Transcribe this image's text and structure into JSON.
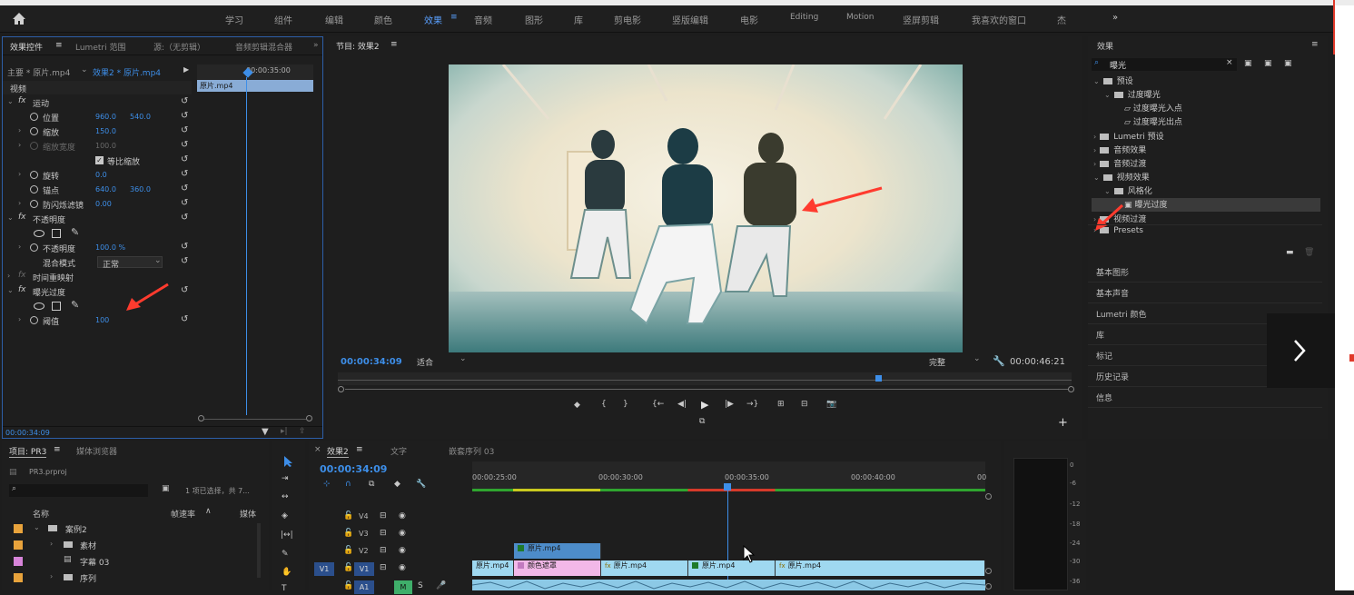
{
  "workspaces": [
    "学习",
    "组件",
    "编辑",
    "颜色",
    "效果",
    "音频",
    "图形",
    "库",
    "剪电影",
    "竖版编辑",
    "电影",
    "Editing",
    "Motion",
    "竖屏剪辑",
    "我喜欢的窗口",
    "杰"
  ],
  "active_workspace": "效果",
  "ec": {
    "tabs": [
      "效果控件",
      "Lumetri 范围",
      "源:（无剪辑）",
      "音频剪辑混合器"
    ],
    "master": "主要 * 原片.mp4",
    "seq": "效果2 * 原片.mp4",
    "mini_time": "00:00:35:00",
    "clip": "原片.mp4",
    "section_video": "视频",
    "motion": "运动",
    "position_lbl": "位置",
    "pos_x": "960.0",
    "pos_y": "540.0",
    "scale_lbl": "缩放",
    "scale": "150.0",
    "scalew_lbl": "缩放宽度",
    "scalew": "100.0",
    "uniform": "等比缩放",
    "rot_lbl": "旋转",
    "rot": "0.0",
    "anchor_lbl": "锚点",
    "anc_x": "640.0",
    "anc_y": "360.0",
    "flicker_lbl": "防闪烁滤镜",
    "flicker": "0.00",
    "opacity": "不透明度",
    "opacity_lbl": "不透明度",
    "opacity_val": "100.0 %",
    "blend_lbl": "混合模式",
    "blend_val": "正常",
    "remap": "时间重映射",
    "solarize": "曝光过度",
    "threshold_lbl": "阈值",
    "threshold": "100",
    "time": "00:00:34:09"
  },
  "program": {
    "title": "节目: 效果2",
    "timecode": "00:00:34:09",
    "fit": "适合",
    "quality": "完整",
    "duration": "00:00:46:21"
  },
  "effects": {
    "title": "效果",
    "search": "曝光",
    "tree": [
      {
        "t": "预设",
        "lvl": 0,
        "f": true
      },
      {
        "t": "过度曝光",
        "lvl": 1,
        "f": true
      },
      {
        "t": "过度曝光入点",
        "lvl": 2,
        "f": false
      },
      {
        "t": "过度曝光出点",
        "lvl": 2,
        "f": false
      },
      {
        "t": "Lumetri 预设",
        "lvl": 0,
        "f": true
      },
      {
        "t": "音频效果",
        "lvl": 0,
        "f": true
      },
      {
        "t": "音频过渡",
        "lvl": 0,
        "f": true
      },
      {
        "t": "视频效果",
        "lvl": 0,
        "f": true
      },
      {
        "t": "风格化",
        "lvl": 1,
        "f": true
      },
      {
        "t": "曝光过度",
        "lvl": 2,
        "f": false
      },
      {
        "t": "视频过渡",
        "lvl": 0,
        "f": true
      },
      {
        "t": "Presets",
        "lvl": 0,
        "f": true
      }
    ],
    "panels": [
      "基本图形",
      "基本声音",
      "Lumetri 颜色",
      "库",
      "标记",
      "历史记录",
      "信息"
    ]
  },
  "project": {
    "tabs": [
      "项目: PR3",
      "媒体浏览器"
    ],
    "file": "PR3.prproj",
    "selinfo": "1 项已选择，共 7...",
    "col_name": "名称",
    "col_rate": "帧速率",
    "col_media": "媒体",
    "items": [
      {
        "name": "案例2",
        "color": "#e8a33c"
      },
      {
        "name": "素材",
        "color": "#e8a33c"
      },
      {
        "name": "字幕 03",
        "color": "#d784d9"
      },
      {
        "name": "序列",
        "color": "#e8a33c"
      }
    ]
  },
  "timeline": {
    "tabs": [
      "效果2",
      "文字",
      "嵌套序列 03"
    ],
    "timecode": "00:00:34:09",
    "ruler": [
      "00:00:25:00",
      "00:00:30:00",
      "00:00:35:00",
      "00:00:40:00",
      "00"
    ],
    "tracks": [
      "V4",
      "V3",
      "V2",
      "V1",
      "A1"
    ],
    "clips": [
      {
        "name": "原片.mp4",
        "color": "#4d8cc9"
      },
      {
        "name": "原片.mp4",
        "color": "#9fd8f0"
      },
      {
        "name": "颜色遮罩",
        "color": "#f2b8e8"
      },
      {
        "name": "原片.mp4",
        "color": "#9fd8f0"
      },
      {
        "name": "原片.mp4",
        "color": "#9fd8f0"
      },
      {
        "name": "原片.mp4",
        "color": "#9fd8f0"
      }
    ]
  },
  "meter": [
    "0",
    "-6",
    "-12",
    "-18",
    "-24",
    "-30",
    "-36"
  ]
}
